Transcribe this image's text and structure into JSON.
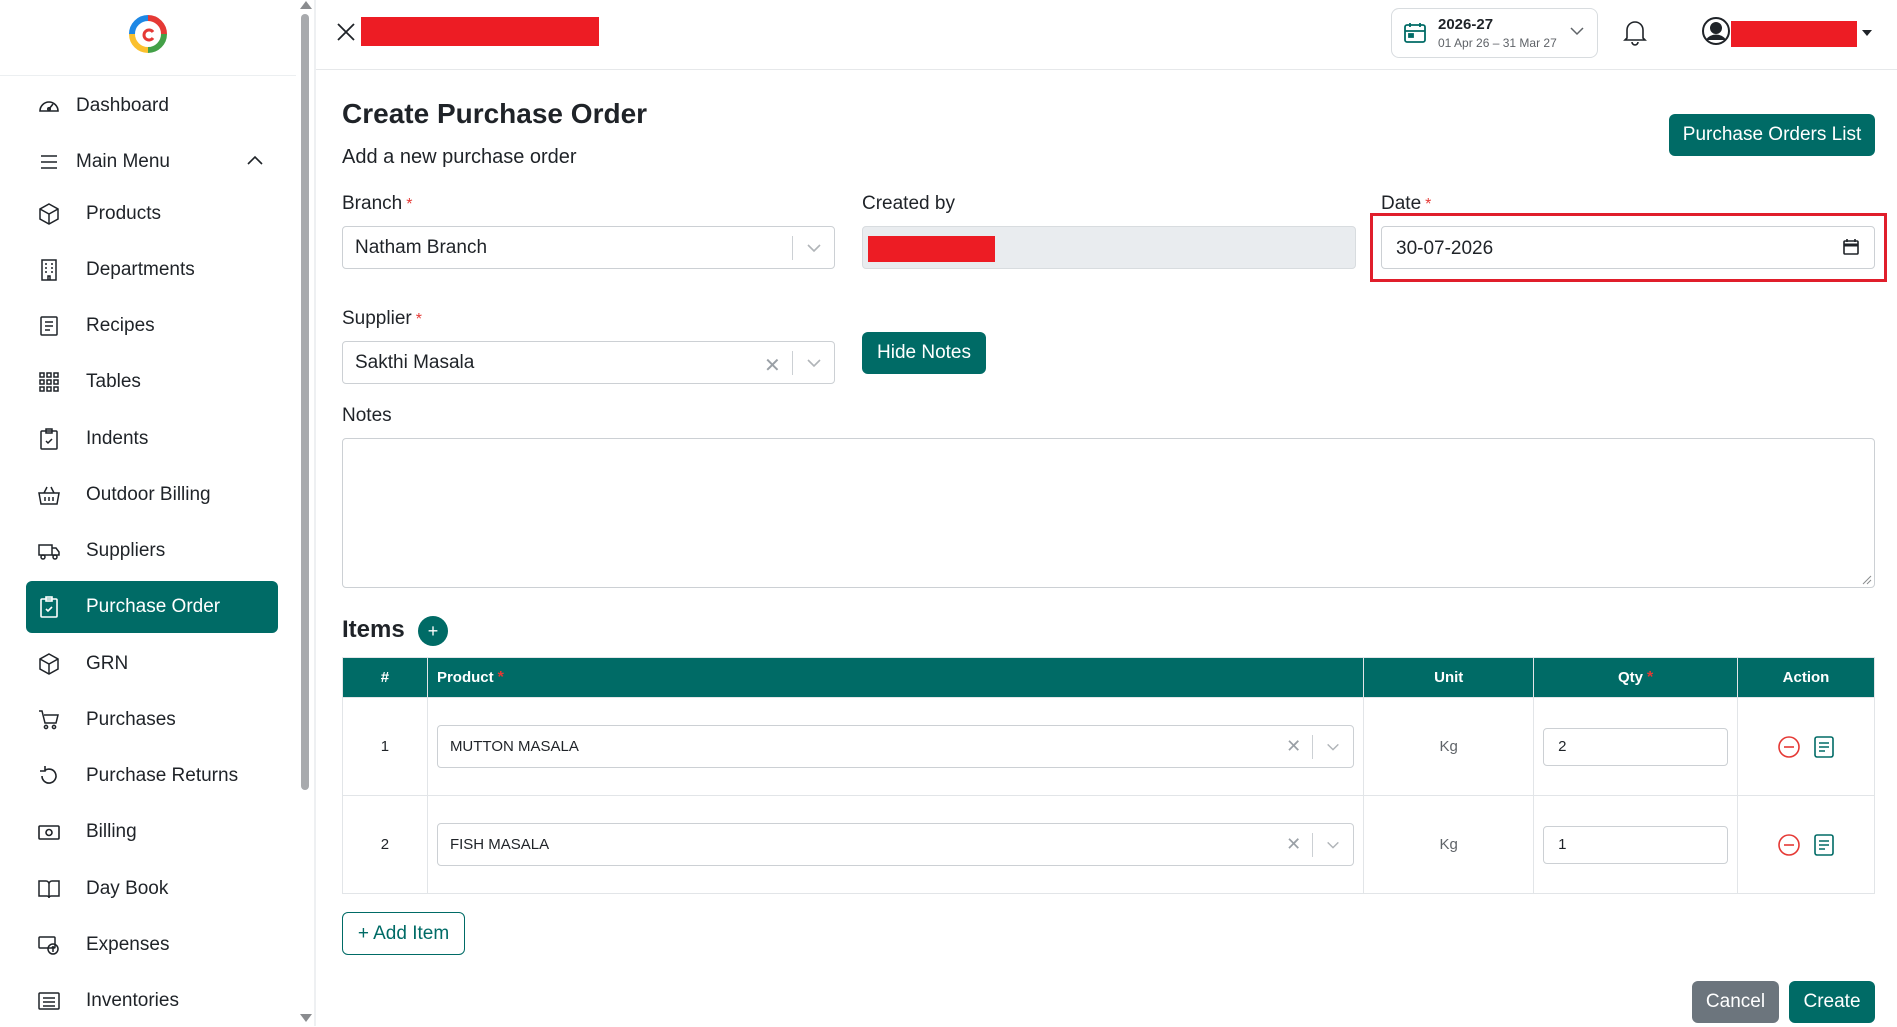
{
  "colors": {
    "brand": "#006b66",
    "danger": "#e53935",
    "redaction": "#ed1c24",
    "muted_button": "#6c757d"
  },
  "sidebar": {
    "logo_icon": "brand-logo-icon",
    "items": [
      {
        "label": "Dashboard",
        "icon": "gauge-icon"
      },
      {
        "label": "Main Menu",
        "icon": "hamburger-icon"
      },
      {
        "label": "Products",
        "icon": "box-icon"
      },
      {
        "label": "Departments",
        "icon": "building-icon"
      },
      {
        "label": "Recipes",
        "icon": "recipe-icon"
      },
      {
        "label": "Tables",
        "icon": "grid-icon"
      },
      {
        "label": "Indents",
        "icon": "clipboard-icon"
      },
      {
        "label": "Outdoor Billing",
        "icon": "basket-icon"
      },
      {
        "label": "Suppliers",
        "icon": "truck-icon"
      },
      {
        "label": "Purchase Order",
        "icon": "clipboard-check-icon"
      },
      {
        "label": "GRN",
        "icon": "box-icon"
      },
      {
        "label": "Purchases",
        "icon": "cart-icon"
      },
      {
        "label": "Purchase Returns",
        "icon": "return-icon"
      },
      {
        "label": "Billing",
        "icon": "cash-icon"
      },
      {
        "label": "Day Book",
        "icon": "book-icon"
      },
      {
        "label": "Expenses",
        "icon": "expenses-icon"
      },
      {
        "label": "Inventories",
        "icon": "list-icon"
      }
    ]
  },
  "header": {
    "financial_year": "2026-27",
    "financial_range": "01 Apr 26 – 31 Mar 27"
  },
  "main": {
    "title": "Create Purchase Order",
    "subtitle": "Add a new purchase order",
    "list_button": "Purchase Orders List",
    "branch_label": "Branch",
    "branch_value": "Natham Branch",
    "created_by_label": "Created by",
    "date_label": "Date",
    "date_value": "30-07-2026",
    "supplier_label": "Supplier",
    "supplier_value": "Sakthi Masala",
    "hide_notes_button": "Hide Notes",
    "notes_label": "Notes",
    "notes_value": "",
    "required_mark": "*"
  },
  "items": {
    "title": "Items",
    "add_icon_label": "+",
    "columns": [
      "#",
      "Product",
      "Unit",
      "Qty",
      "Action"
    ],
    "rows": [
      {
        "index": "1",
        "product": "MUTTON MASALA",
        "unit": "Kg",
        "qty": "2"
      },
      {
        "index": "2",
        "product": "FISH MASALA",
        "unit": "Kg",
        "qty": "1"
      }
    ],
    "add_item_button": "+ Add Item"
  },
  "footer": {
    "cancel": "Cancel",
    "create": "Create"
  }
}
